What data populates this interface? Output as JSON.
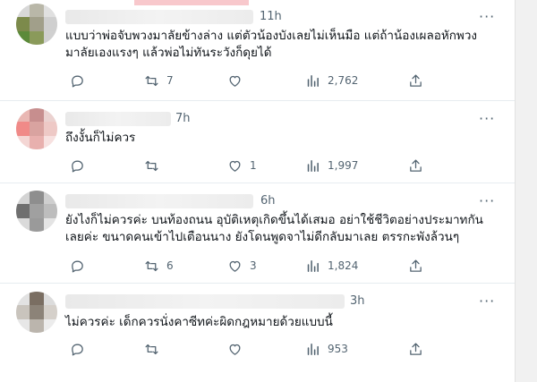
{
  "tweets": [
    {
      "time": "11h",
      "text_line1": "แบบว่าพ่อจับพวงมาลัยข้างล่าง แต่ตัวน้องบังเลยไม่เห็นมือ แต่ถ้าน้องเผลอหักพวง",
      "text_line2": "มาลัยเองแรงๆ แล้วพ่อไม่ทันระวังก็ดุยได้",
      "replies": "",
      "retweets": "7",
      "likes": "",
      "views": "2,762"
    },
    {
      "time": "7h",
      "text_line1": "ถึงงั้นก็ไม่ควร",
      "text_line2": "",
      "replies": "",
      "retweets": "",
      "likes": "1",
      "views": "1,997"
    },
    {
      "time": "6h",
      "text_line1": "ยังไงก็ไม่ควรค่ะ บนท้องถนน อุบัติเหตุเกิดขึ้นได้เสมอ  อย่าใช้ชีวิตอย่างประมาทกัน",
      "text_line2": "เลยค่ะ ขนาดคนเข้าไปเตือนนาง ยังโดนพูดจาไม่ดีกลับมาเลย ตรรกะพังล้วนๆ",
      "replies": "",
      "retweets": "6",
      "likes": "3",
      "views": "1,824"
    },
    {
      "time": "3h",
      "text_line1": "ไม่ควรค่ะ เด็กควรนั่งคาซีทค่ะผิดกฎหมายด้วยแบบนี้",
      "text_line2": "",
      "replies": "",
      "retweets": "",
      "likes": "",
      "views": "953"
    }
  ],
  "icons": {
    "reply": "reply-icon",
    "retweet": "retweet-icon",
    "like": "heart-icon",
    "views": "views-icon",
    "share": "share-icon",
    "more": "more-icon"
  },
  "colors": {
    "text": "#0f1419",
    "muted": "#536471",
    "divider": "#e6ecf0"
  }
}
